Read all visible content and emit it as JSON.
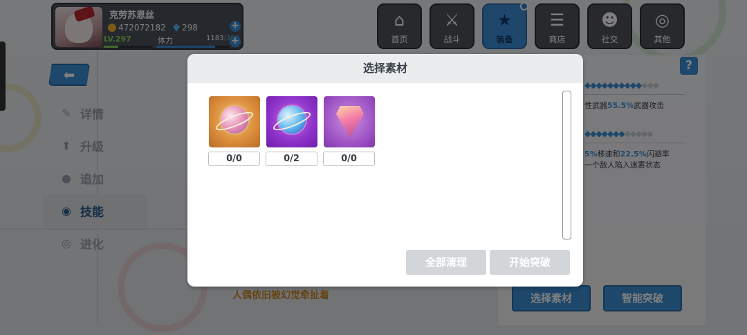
{
  "player": {
    "name": "克劳苏恩丝",
    "gold": "472072182",
    "gems": "298",
    "level": "LV.297",
    "stamina_label": "体力",
    "stamina_current": "1183",
    "stamina_max": "/300"
  },
  "nav": [
    {
      "label": "首页",
      "icon": "home-icon"
    },
    {
      "label": "战斗",
      "icon": "crossed-swords-icon"
    },
    {
      "label": "装备",
      "icon": "star-gun-icon"
    },
    {
      "label": "商店",
      "icon": "shop-cart-icon"
    },
    {
      "label": "社交",
      "icon": "ghost-icon"
    },
    {
      "label": "其他",
      "icon": "target-icon"
    }
  ],
  "side_menu": [
    {
      "label": "详情",
      "icon": "gun-icon"
    },
    {
      "label": "升级",
      "icon": "up-arrow-icon"
    },
    {
      "label": "追加",
      "icon": "plus-blob-icon"
    },
    {
      "label": "技能",
      "icon": "gear-target-icon"
    },
    {
      "label": "进化",
      "icon": "swirl-icon"
    }
  ],
  "right_panel": {
    "help": "?",
    "row1_text_a": "性武器",
    "row1_pct": "55.5%",
    "row1_text_b": "武器攻击",
    "row2_pct_a": "5%",
    "row2_text_a": "移速和",
    "row2_pct_b": "22.5%",
    "row2_text_b": "闪避率",
    "row3_text": "一个敌人陷入迷雾状态"
  },
  "flavor_text": "人偶依旧被幻觉牵扯着",
  "bottom_buttons": {
    "select": "选择素材",
    "smart": "智能突破"
  },
  "modal": {
    "title": "选择素材",
    "items": [
      {
        "name": "orange-orb-material",
        "count": "0/0"
      },
      {
        "name": "purple-orb-material",
        "count": "0/2"
      },
      {
        "name": "pink-gem-material",
        "count": "0/0"
      }
    ],
    "clear_label": "全部清理",
    "start_label": "开始突破"
  },
  "colors": {
    "accent": "#3a8fd6",
    "disabled_button": "#d3d6d9",
    "flavor": "#c9892c"
  }
}
